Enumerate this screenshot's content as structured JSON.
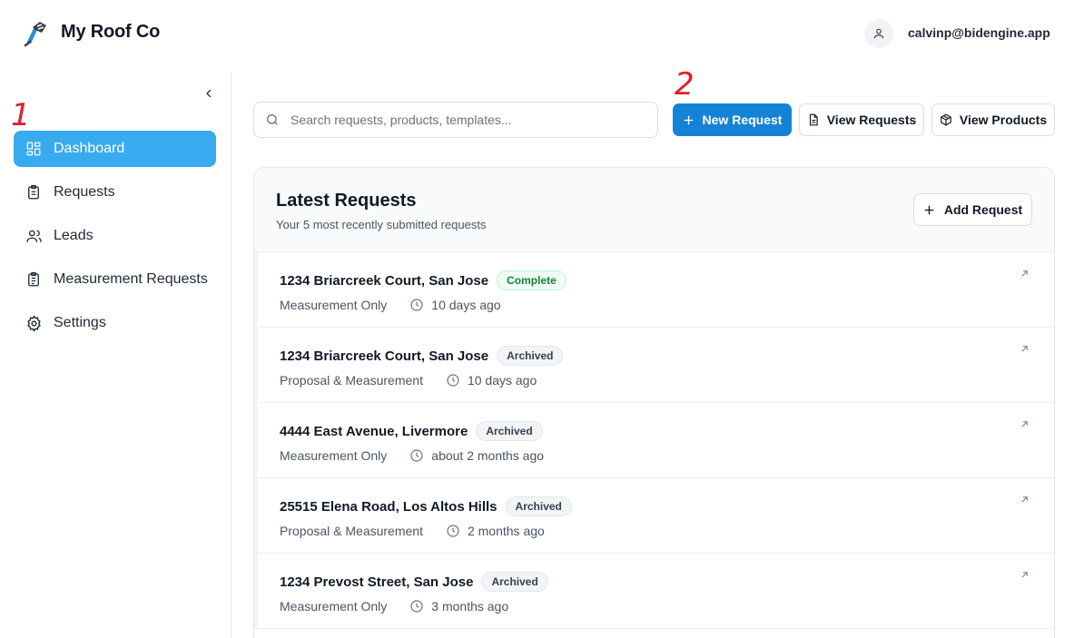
{
  "header": {
    "brand": "My Roof Co",
    "user_email": "calvinp@bidengine.app"
  },
  "sidebar": {
    "items": [
      {
        "label": "Dashboard",
        "icon": "dashboard-grid-icon",
        "active": true
      },
      {
        "label": "Requests",
        "icon": "clipboard-icon"
      },
      {
        "label": "Leads",
        "icon": "users-icon"
      },
      {
        "label": "Measurement Requests",
        "icon": "clipboard-list-icon"
      },
      {
        "label": "Settings",
        "icon": "gear-icon"
      }
    ]
  },
  "annotations": {
    "one": "1",
    "two": "2"
  },
  "toolbar": {
    "search_placeholder": "Search requests, products, templates...",
    "new_request": "New Request",
    "view_requests": "View Requests",
    "view_products": "View Products"
  },
  "latest": {
    "title": "Latest Requests",
    "subtitle": "Your 5 most recently submitted requests",
    "add_button": "Add Request",
    "rows": [
      {
        "address": "1234 Briarcreek Court, San Jose",
        "status": "Complete",
        "type": "Measurement Only",
        "time": "10 days ago"
      },
      {
        "address": "1234 Briarcreek Court, San Jose",
        "status": "Archived",
        "type": "Proposal & Measurement",
        "time": "10 days ago"
      },
      {
        "address": "4444 East Avenue, Livermore",
        "status": "Archived",
        "type": "Measurement Only",
        "time": "about 2 months ago"
      },
      {
        "address": "25515 Elena Road, Los Altos Hills",
        "status": "Archived",
        "type": "Proposal & Measurement",
        "time": "2 months ago"
      },
      {
        "address": "1234 Prevost Street, San Jose",
        "status": "Archived",
        "type": "Measurement Only",
        "time": "3 months ago"
      }
    ]
  },
  "colors": {
    "accent": "#38aaf0",
    "primary_button": "#1483d6",
    "annotation": "#e11d2a",
    "complete": "#15803d"
  }
}
